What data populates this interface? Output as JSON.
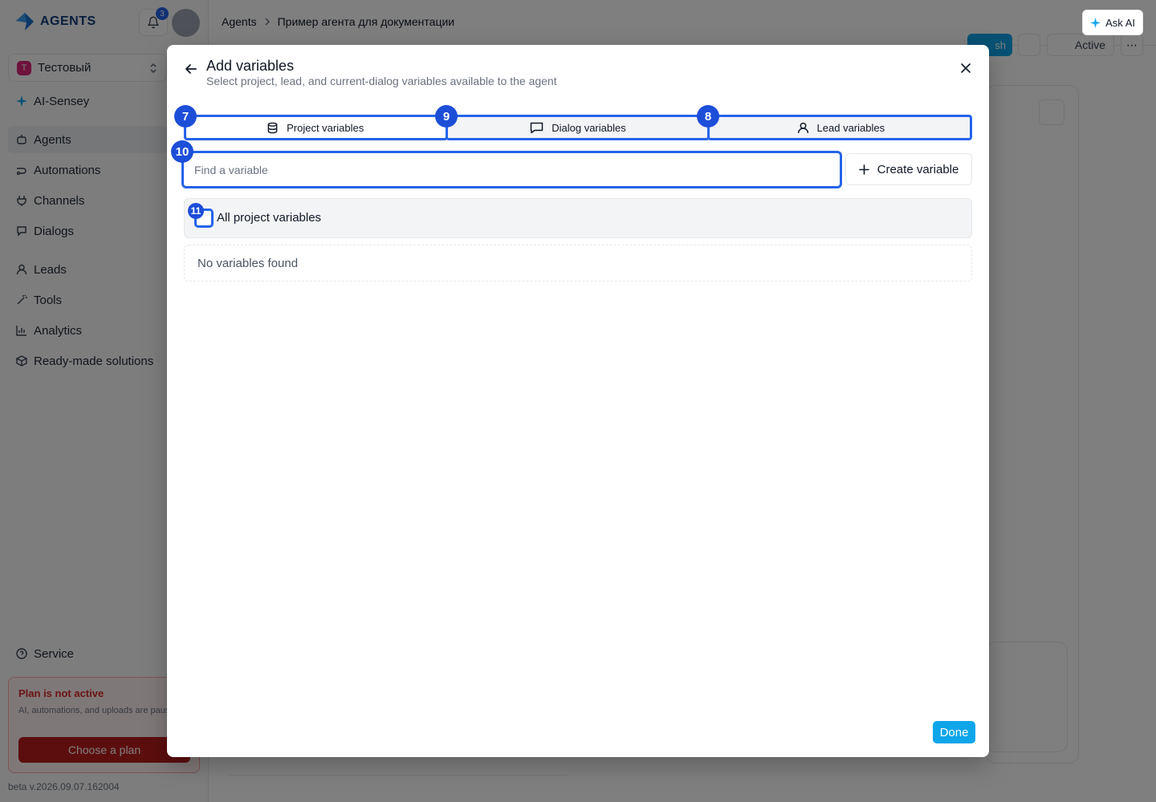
{
  "sidebar": {
    "logo_text": "AGENTS",
    "notification_count": "3",
    "project": {
      "initial": "Т",
      "name": "Тестовый"
    },
    "items": [
      {
        "label": "AI-Sensey",
        "icon": "sparkle-icon"
      },
      {
        "label": "Agents",
        "icon": "agents-icon",
        "active": true
      },
      {
        "label": "Automations",
        "icon": "automation-icon"
      },
      {
        "label": "Channels",
        "icon": "channels-icon"
      },
      {
        "label": "Dialogs",
        "icon": "dialogs-icon"
      },
      {
        "label": "Leads",
        "icon": "user-icon"
      },
      {
        "label": "Tools",
        "icon": "wand-icon"
      },
      {
        "label": "Analytics",
        "icon": "chart-icon"
      },
      {
        "label": "Ready-made solutions",
        "icon": "box-icon"
      }
    ],
    "service_label": "Service",
    "plan": {
      "title": "Plan is not active",
      "description": "AI, automations, and uploads are paused.",
      "button": "Choose a plan"
    },
    "version": "beta v.2026.09.07.162004"
  },
  "header": {
    "breadcrumb": [
      "Agents",
      "Пример агента для документации"
    ],
    "ask_ai": "Ask AI",
    "publish_partial": "sh",
    "status": "Active"
  },
  "modal": {
    "title": "Add variables",
    "subtitle": "Select project, lead, and current-dialog variables available to the agent",
    "tabs": [
      {
        "label": "Project variables",
        "icon": "database-icon",
        "active": true
      },
      {
        "label": "Dialog variables",
        "icon": "message-icon",
        "active": false
      },
      {
        "label": "Lead variables",
        "icon": "user-icon",
        "active": false
      }
    ],
    "search_placeholder": "Find a variable",
    "create_button": "Create variable",
    "all_label": "All project variables",
    "all_checked": false,
    "empty_text": "No variables found",
    "done_button": "Done"
  },
  "markers": [
    "7",
    "9",
    "8",
    "10",
    "11"
  ],
  "colors": {
    "accent": "#2563eb",
    "primary_button": "#0ea5e9",
    "danger": "#dc2626",
    "marker": "#1d4ed8"
  }
}
